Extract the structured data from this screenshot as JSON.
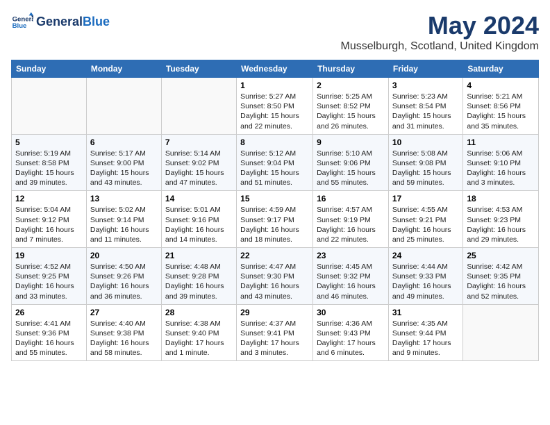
{
  "header": {
    "logo_line1": "General",
    "logo_line2": "Blue",
    "title": "May 2024",
    "subtitle": "Musselburgh, Scotland, United Kingdom"
  },
  "days_of_week": [
    "Sunday",
    "Monday",
    "Tuesday",
    "Wednesday",
    "Thursday",
    "Friday",
    "Saturday"
  ],
  "weeks": [
    {
      "days": [
        {
          "number": "",
          "info": ""
        },
        {
          "number": "",
          "info": ""
        },
        {
          "number": "",
          "info": ""
        },
        {
          "number": "1",
          "info": "Sunrise: 5:27 AM\nSunset: 8:50 PM\nDaylight: 15 hours\nand 22 minutes."
        },
        {
          "number": "2",
          "info": "Sunrise: 5:25 AM\nSunset: 8:52 PM\nDaylight: 15 hours\nand 26 minutes."
        },
        {
          "number": "3",
          "info": "Sunrise: 5:23 AM\nSunset: 8:54 PM\nDaylight: 15 hours\nand 31 minutes."
        },
        {
          "number": "4",
          "info": "Sunrise: 5:21 AM\nSunset: 8:56 PM\nDaylight: 15 hours\nand 35 minutes."
        }
      ]
    },
    {
      "days": [
        {
          "number": "5",
          "info": "Sunrise: 5:19 AM\nSunset: 8:58 PM\nDaylight: 15 hours\nand 39 minutes."
        },
        {
          "number": "6",
          "info": "Sunrise: 5:17 AM\nSunset: 9:00 PM\nDaylight: 15 hours\nand 43 minutes."
        },
        {
          "number": "7",
          "info": "Sunrise: 5:14 AM\nSunset: 9:02 PM\nDaylight: 15 hours\nand 47 minutes."
        },
        {
          "number": "8",
          "info": "Sunrise: 5:12 AM\nSunset: 9:04 PM\nDaylight: 15 hours\nand 51 minutes."
        },
        {
          "number": "9",
          "info": "Sunrise: 5:10 AM\nSunset: 9:06 PM\nDaylight: 15 hours\nand 55 minutes."
        },
        {
          "number": "10",
          "info": "Sunrise: 5:08 AM\nSunset: 9:08 PM\nDaylight: 15 hours\nand 59 minutes."
        },
        {
          "number": "11",
          "info": "Sunrise: 5:06 AM\nSunset: 9:10 PM\nDaylight: 16 hours\nand 3 minutes."
        }
      ]
    },
    {
      "days": [
        {
          "number": "12",
          "info": "Sunrise: 5:04 AM\nSunset: 9:12 PM\nDaylight: 16 hours\nand 7 minutes."
        },
        {
          "number": "13",
          "info": "Sunrise: 5:02 AM\nSunset: 9:14 PM\nDaylight: 16 hours\nand 11 minutes."
        },
        {
          "number": "14",
          "info": "Sunrise: 5:01 AM\nSunset: 9:16 PM\nDaylight: 16 hours\nand 14 minutes."
        },
        {
          "number": "15",
          "info": "Sunrise: 4:59 AM\nSunset: 9:17 PM\nDaylight: 16 hours\nand 18 minutes."
        },
        {
          "number": "16",
          "info": "Sunrise: 4:57 AM\nSunset: 9:19 PM\nDaylight: 16 hours\nand 22 minutes."
        },
        {
          "number": "17",
          "info": "Sunrise: 4:55 AM\nSunset: 9:21 PM\nDaylight: 16 hours\nand 25 minutes."
        },
        {
          "number": "18",
          "info": "Sunrise: 4:53 AM\nSunset: 9:23 PM\nDaylight: 16 hours\nand 29 minutes."
        }
      ]
    },
    {
      "days": [
        {
          "number": "19",
          "info": "Sunrise: 4:52 AM\nSunset: 9:25 PM\nDaylight: 16 hours\nand 33 minutes."
        },
        {
          "number": "20",
          "info": "Sunrise: 4:50 AM\nSunset: 9:26 PM\nDaylight: 16 hours\nand 36 minutes."
        },
        {
          "number": "21",
          "info": "Sunrise: 4:48 AM\nSunset: 9:28 PM\nDaylight: 16 hours\nand 39 minutes."
        },
        {
          "number": "22",
          "info": "Sunrise: 4:47 AM\nSunset: 9:30 PM\nDaylight: 16 hours\nand 43 minutes."
        },
        {
          "number": "23",
          "info": "Sunrise: 4:45 AM\nSunset: 9:32 PM\nDaylight: 16 hours\nand 46 minutes."
        },
        {
          "number": "24",
          "info": "Sunrise: 4:44 AM\nSunset: 9:33 PM\nDaylight: 16 hours\nand 49 minutes."
        },
        {
          "number": "25",
          "info": "Sunrise: 4:42 AM\nSunset: 9:35 PM\nDaylight: 16 hours\nand 52 minutes."
        }
      ]
    },
    {
      "days": [
        {
          "number": "26",
          "info": "Sunrise: 4:41 AM\nSunset: 9:36 PM\nDaylight: 16 hours\nand 55 minutes."
        },
        {
          "number": "27",
          "info": "Sunrise: 4:40 AM\nSunset: 9:38 PM\nDaylight: 16 hours\nand 58 minutes."
        },
        {
          "number": "28",
          "info": "Sunrise: 4:38 AM\nSunset: 9:40 PM\nDaylight: 17 hours\nand 1 minute."
        },
        {
          "number": "29",
          "info": "Sunrise: 4:37 AM\nSunset: 9:41 PM\nDaylight: 17 hours\nand 3 minutes."
        },
        {
          "number": "30",
          "info": "Sunrise: 4:36 AM\nSunset: 9:43 PM\nDaylight: 17 hours\nand 6 minutes."
        },
        {
          "number": "31",
          "info": "Sunrise: 4:35 AM\nSunset: 9:44 PM\nDaylight: 17 hours\nand 9 minutes."
        },
        {
          "number": "",
          "info": ""
        }
      ]
    }
  ]
}
